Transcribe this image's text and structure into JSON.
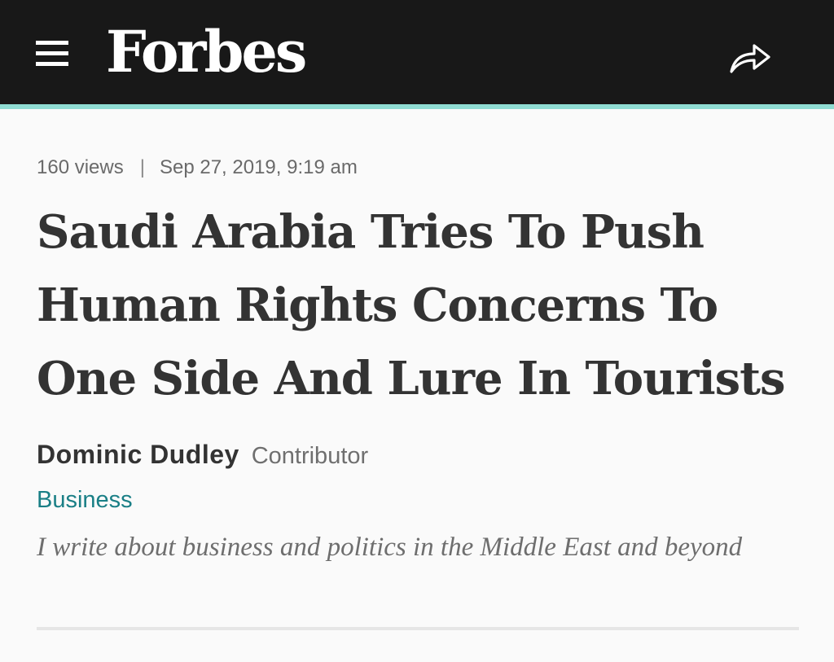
{
  "header": {
    "brand": "Forbes",
    "menu_icon": "hamburger-menu-icon",
    "share_icon": "share-arrow-icon",
    "background_color": "#181818",
    "accent_color": "#8fdcd2"
  },
  "article": {
    "views": "160 views",
    "separator": "|",
    "date": "Sep 27, 2019, 9:19 am",
    "headline": "Saudi Arabia Tries To Push Human Rights Concerns To One Side And Lure In Tourists",
    "author": {
      "name": "Dominic Dudley",
      "role": "Contributor"
    },
    "section": "Business",
    "section_color": "#1a7f86",
    "bio": "I write about business and politics in the Middle East and beyond"
  }
}
